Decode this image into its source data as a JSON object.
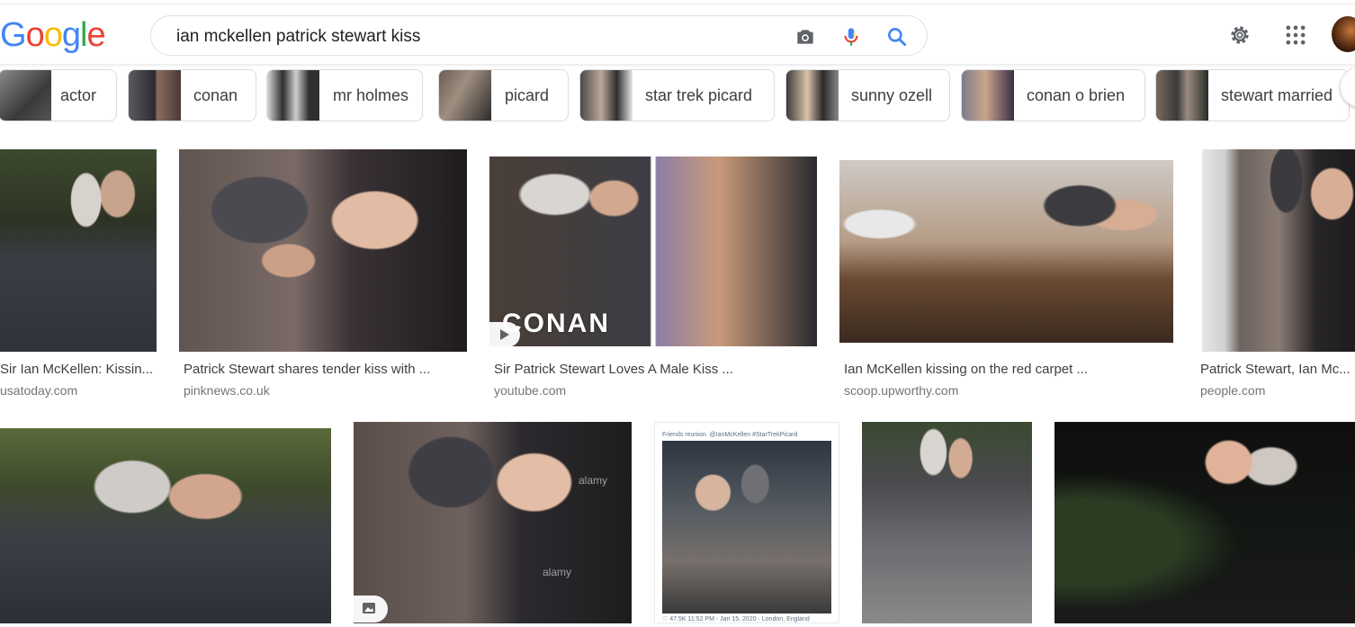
{
  "logo": [
    "G",
    "o",
    "o",
    "g",
    "l",
    "e"
  ],
  "colors": {
    "blue": "#4285f4",
    "red": "#ea4335",
    "yellow": "#fbbc05",
    "green": "#34a853"
  },
  "search": {
    "query": "ian mckellen patrick stewart kiss"
  },
  "header_icons": [
    "camera-icon",
    "mic-icon",
    "search-icon",
    "settings-gear-icon",
    "apps-grid-icon",
    "account-avatar"
  ],
  "chips": [
    {
      "label": "actor"
    },
    {
      "label": "conan"
    },
    {
      "label": "mr holmes"
    },
    {
      "label": "picard"
    },
    {
      "label": "star trek picard"
    },
    {
      "label": "sunny ozell"
    },
    {
      "label": "conan o brien"
    },
    {
      "label": "stewart married"
    }
  ],
  "results": [
    {
      "caption": "Sir Ian McKellen: Kissin...",
      "source": "usatoday.com"
    },
    {
      "caption": "Patrick Stewart shares tender kiss with ...",
      "source": "pinknews.co.uk"
    },
    {
      "caption": "Sir Patrick Stewart Loves A Male Kiss ...",
      "source": "youtube.com",
      "overlay": "CONAN"
    },
    {
      "caption": "Ian McKellen kissing on the red carpet ...",
      "source": "scoop.upworthy.com"
    },
    {
      "caption": "Patrick Stewart, Ian Mc...",
      "source": "people.com"
    }
  ],
  "row2": [
    {
      "watermark": ""
    },
    {
      "watermark": "alamy"
    },
    {
      "tweet_line": "Friends reunion. @IanMcKellen #StarTrekPicard",
      "tweet_footer": "♡ 47.5K  11:52 PM - Jan 15, 2020 · London, England"
    },
    {
      "watermark": ""
    },
    {
      "watermark": ""
    }
  ]
}
